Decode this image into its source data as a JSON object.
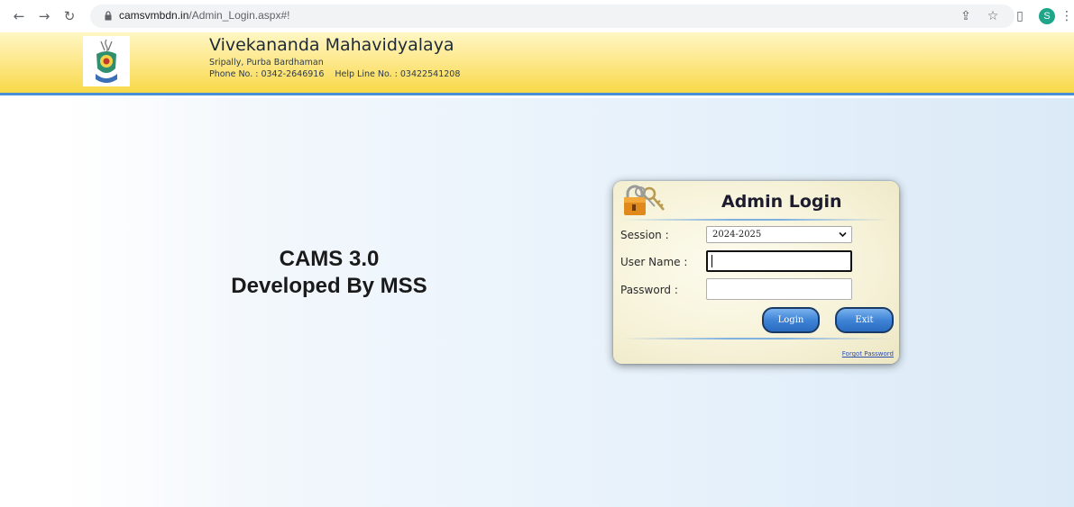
{
  "browser": {
    "url_domain": "camsvmbdn.in",
    "url_path": "/Admin_Login.aspx#!",
    "profile_initial": "S"
  },
  "header": {
    "college_name": "Vivekananda Mahavidyalaya",
    "address": "Sripally, Purba Bardhaman",
    "phone_label": "Phone No. : 0342-2646916",
    "helpline_label": "Help Line No. : 03422541208"
  },
  "main": {
    "title_line1": "CAMS 3.0",
    "title_line2": "Developed By MSS"
  },
  "login": {
    "title": "Admin Login",
    "session_label": "Session :",
    "session_value": "2024-2025",
    "username_label": "User Name :",
    "username_value": "",
    "password_label": "Password :",
    "password_value": "",
    "login_button": "Login",
    "exit_button": "Exit",
    "forgot_link": "Forgot Password"
  },
  "colors": {
    "header_yellow": "#f8d948",
    "header_border": "#4a8fd6",
    "button_blue": "#3f84d6",
    "profile_green": "#1fa58a"
  }
}
